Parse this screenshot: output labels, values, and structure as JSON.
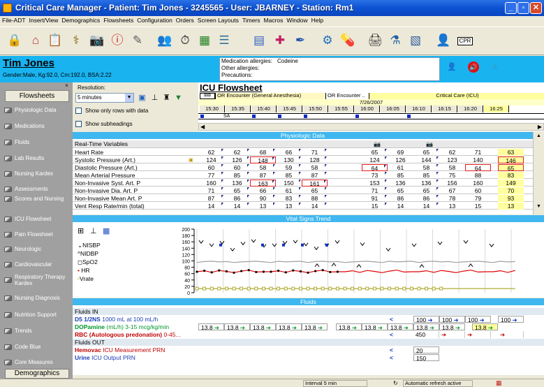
{
  "window": {
    "title": "Critical Care Manager - Patient: Tim Jones - 3245565 - User: JBARNEY - Station: Rm1"
  },
  "menu": [
    "File-ADT",
    "Insert/View",
    "Demographics",
    "Flowsheets",
    "Configuration",
    "Orders",
    "Screen Layouts",
    "Timers",
    "Macros",
    "Window",
    "Help"
  ],
  "toolbar": {
    "cpr_label": "CPR"
  },
  "patient": {
    "name": "Tim Jones",
    "demographics": "Gender:Male, Kg:92.0, Cm:192.0, BSA:2.22",
    "medication_allergies_label": "Medication allergies:",
    "medication_allergies_value": "Codeine",
    "other_allergies_label": "Other allergies:",
    "precautions_label": "Precautions:"
  },
  "sidebar": {
    "title": "Flowsheets",
    "items": [
      "Physiologic Data",
      "Medications",
      "Fluids",
      "Lab Results",
      "Nursing Kardex",
      "Assessments",
      "Scores and Nursing",
      "ICU Flowsheet",
      "Pain Flowsheet",
      "Neurologic",
      "Cardiovascular",
      "Respiratory Therapy Kardex",
      "Nursing Diagnosis",
      "Nutrition Support",
      "Trends",
      "Code Blue",
      "Core Measures"
    ],
    "bottom": "Demographics"
  },
  "controls": {
    "resolution_label": "Resolution:",
    "resolution_value": "5 minutes",
    "show_only_rows": "Show only rows with data",
    "show_subheadings": "Show subheadings"
  },
  "flowsheet": {
    "title": "ICU Flowsheet",
    "encounter1": "OR Encounter (General Anesthesia)",
    "encounter2": "OR Encounter ..",
    "encounter3": "Critical Care (ICU)",
    "date": "7/26/2007",
    "times": [
      "15:30",
      "15:35",
      "15:40",
      "15:45",
      "15:50",
      "15:55",
      "16:00",
      "16:05",
      "16:10",
      "16:15",
      "16:20",
      "16:25"
    ],
    "marker": "SA"
  },
  "physio": {
    "section_title": "Physiologic Data",
    "header": "Real-Time Variables",
    "rows": [
      {
        "name": "Heart Rate",
        "values": [
          "62",
          "62",
          "68",
          "66",
          "71",
          "",
          "65",
          "69",
          "65",
          "62",
          "71",
          "63"
        ]
      },
      {
        "name": "Systolic Pressure (Art.)",
        "values": [
          "124",
          "126",
          "148",
          "130",
          "128",
          "",
          "124",
          "126",
          "144",
          "123",
          "140",
          "146"
        ]
      },
      {
        "name": "Diastolic Pressure (Art.)",
        "values": [
          "60",
          "60",
          "58",
          "59",
          "58",
          "",
          "64",
          "61",
          "58",
          "58",
          "64",
          "65"
        ]
      },
      {
        "name": "Mean Arterial Pressure",
        "values": [
          "77",
          "85",
          "87",
          "85",
          "87",
          "",
          "73",
          "85",
          "85",
          "75",
          "88",
          "83"
        ]
      },
      {
        "name": "Non-Invasive Syst. Art. P",
        "values": [
          "160",
          "136",
          "163",
          "150",
          "161",
          "",
          "153",
          "136",
          "136",
          "156",
          "160",
          "149"
        ]
      },
      {
        "name": "Non-Invasive Dia. Art. P",
        "values": [
          "71",
          "65",
          "66",
          "61",
          "65",
          "",
          "71",
          "65",
          "65",
          "67",
          "60",
          "70"
        ]
      },
      {
        "name": "Non-Invasive Mean Art. P",
        "values": [
          "87",
          "86",
          "90",
          "83",
          "88",
          "",
          "91",
          "86",
          "86",
          "78",
          "79",
          "93"
        ]
      },
      {
        "name": "Vent Resp Rate/min (total)",
        "values": [
          "14",
          "14",
          "13",
          "13",
          "14",
          "",
          "15",
          "14",
          "14",
          "13",
          "15",
          "13"
        ]
      }
    ]
  },
  "trend": {
    "section_title": "Vital Signs Trend",
    "y_ticks": [
      "200",
      "180",
      "160",
      "140",
      "120",
      "100",
      "80",
      "60",
      "40",
      "20",
      "0"
    ],
    "legend": [
      "NISBP",
      "NIDBP",
      "SpO2",
      "HR",
      "Vrate"
    ],
    "colors": {
      "hr": "#e00000",
      "spo2": "#a0a0a0",
      "vrate": "#9a9a00",
      "bp": "#000000"
    }
  },
  "fluids": {
    "section_title": "Fluids",
    "in_label": "Fluids IN",
    "out_label": "Fluids OUT",
    "rows": [
      {
        "name_bold": "D5 1/2NS",
        "name_rest": " 1000 mL at 100 mL/h",
        "color": "#1a3db5"
      },
      {
        "name_bold": "DOPamine",
        "name_rest": " (mL/h) 3-15 mcg/kg/min",
        "color": "#00962a"
      },
      {
        "name_bold": "RBC (Autologous predonation)",
        "name_rest": " 0-45...",
        "color": "#c00000"
      },
      {
        "name_bold": "Hemovac",
        "name_rest": " ICU Measurement PRN",
        "color": "#c00000"
      },
      {
        "name_bold": "Urine",
        "name_rest": " ICU Output PRN",
        "color": "#1a3db5"
      }
    ],
    "d5_values": [
      "100",
      "100",
      "100",
      "100"
    ],
    "dopamine_value": "13.8",
    "rbc_value": "450",
    "hemovac_value": "20",
    "urine_value": "150"
  },
  "status": {
    "interval": "Interval 5 min",
    "refresh": "Automatic refresh active"
  }
}
